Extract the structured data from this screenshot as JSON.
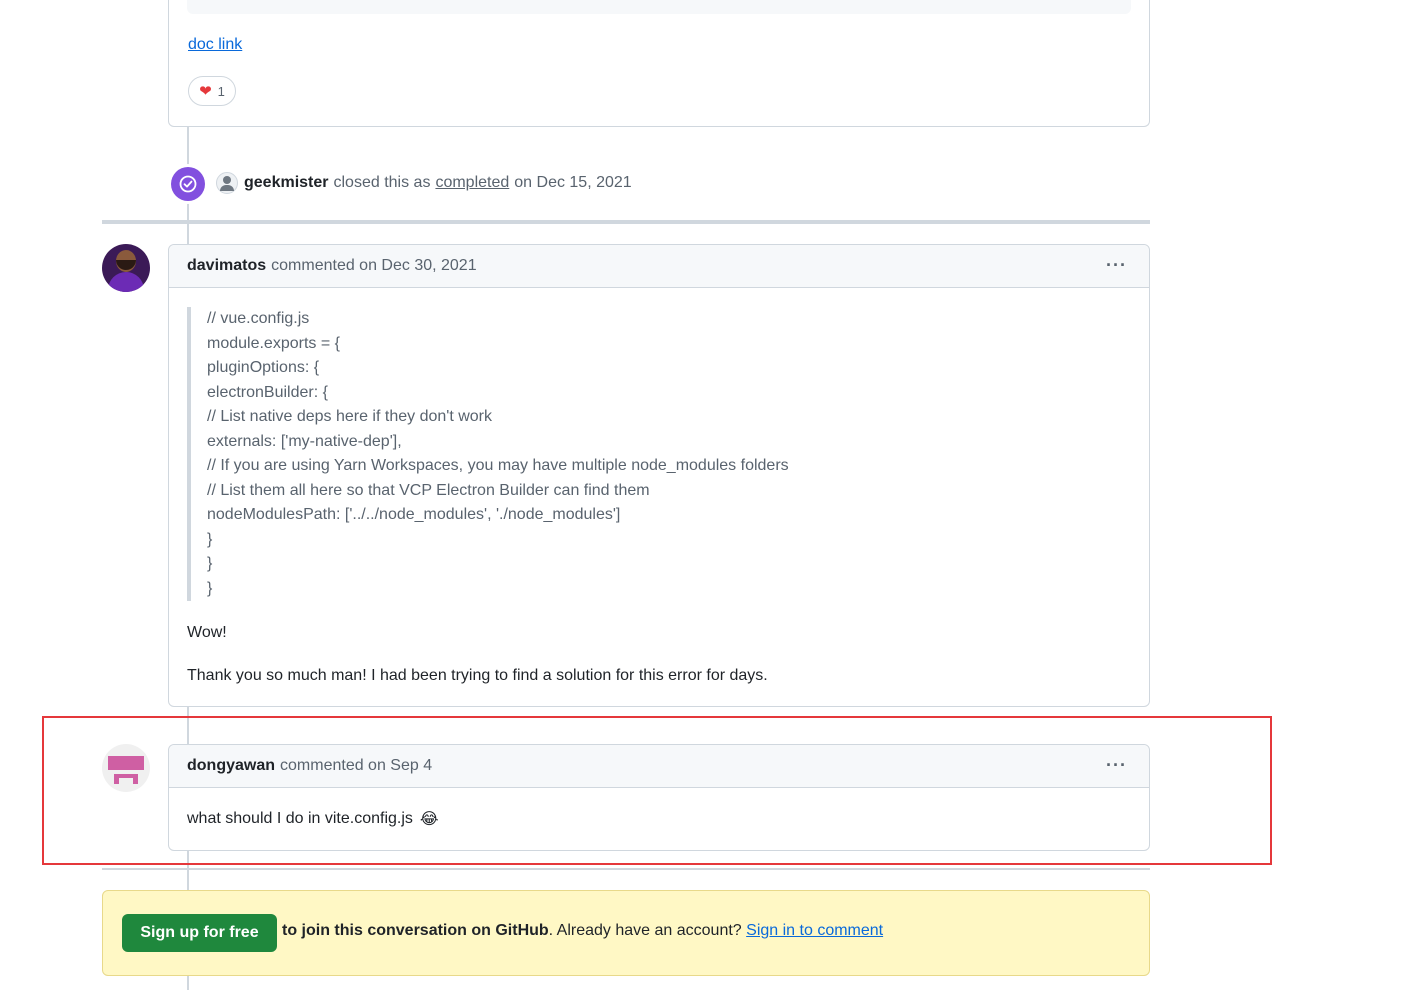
{
  "top_comment": {
    "doc_link": "doc link",
    "reaction_count": "1"
  },
  "event": {
    "user": "geekmister",
    "action_prefix": "closed this as",
    "action_link": "completed",
    "date_text": "on Dec 15, 2021"
  },
  "comment1": {
    "author": "davimatos",
    "meta": "commented on Dec 30, 2021",
    "code_lines": [
      "// vue.config.js",
      "module.exports = {",
      "pluginOptions: {",
      "electronBuilder: {",
      "// List native deps here if they don't work",
      "externals: ['my-native-dep'],",
      "// If you are using Yarn Workspaces, you may have multiple node_modules folders",
      "// List them all here so that VCP Electron Builder can find them",
      "nodeModulesPath: ['../../node_modules', './node_modules']",
      "}",
      "}",
      "}"
    ],
    "paragraph1": "Wow!",
    "paragraph2": "Thank you so much man! I had been trying to find a solution for this error for days."
  },
  "comment2": {
    "author": "dongyawan",
    "meta": "commented on Sep 4",
    "body": "what should I do in vite.config.js",
    "emoji": "😂"
  },
  "signup": {
    "button": "Sign up for free",
    "text_bold": "to join this conversation on GitHub",
    "text": ". Already have an account?",
    "link": "Sign in to comment"
  },
  "colors": {
    "accent_link": "#0969da",
    "signup_green": "#1f883d",
    "highlight_red": "#e5383b",
    "banner_bg": "#fff8c5",
    "closed_purple": "#8250df"
  }
}
